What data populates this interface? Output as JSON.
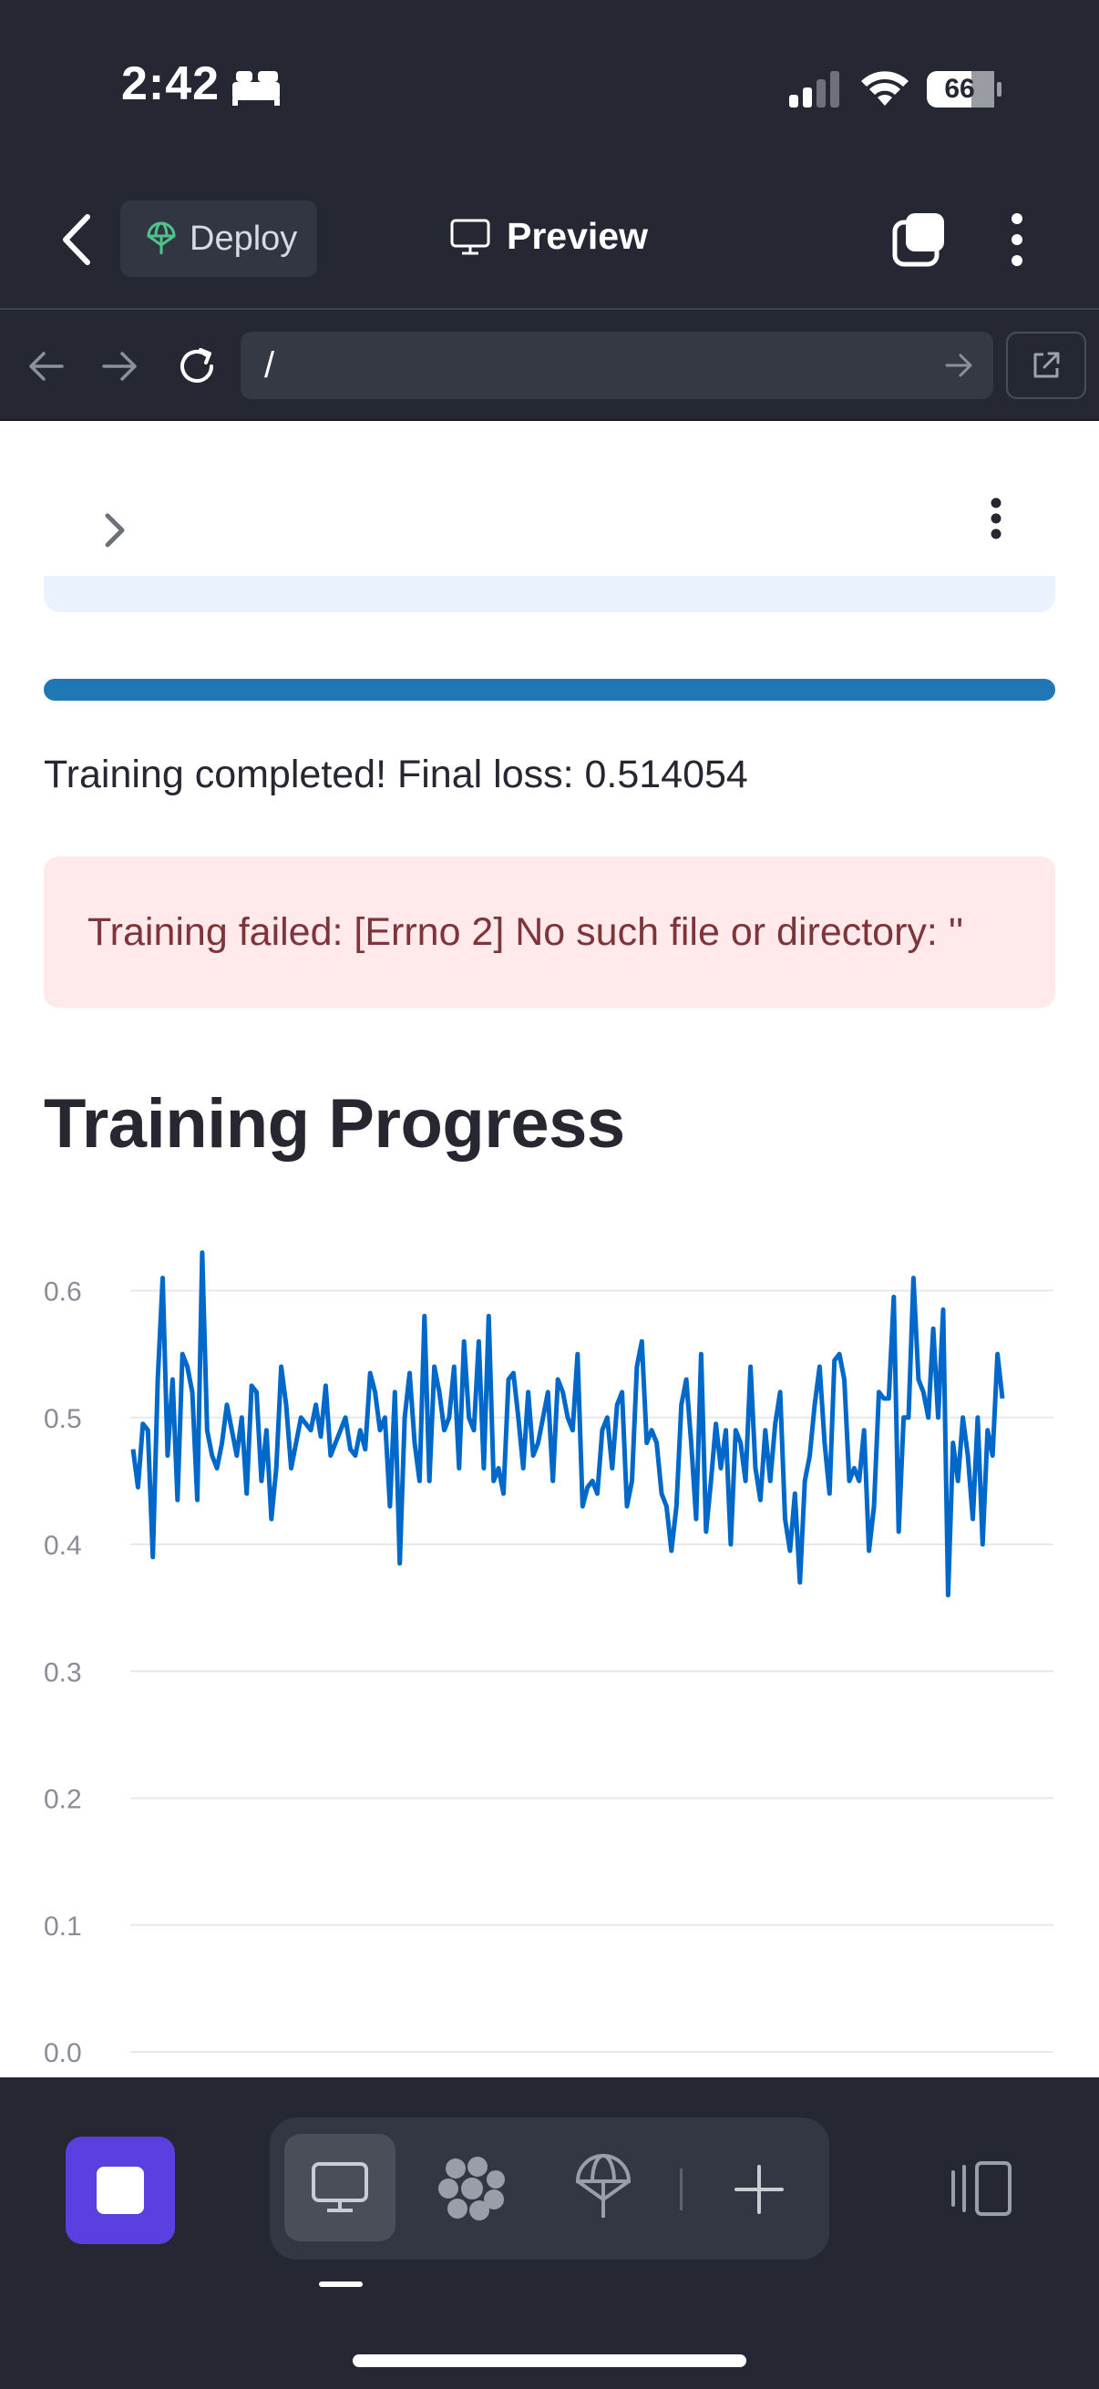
{
  "status_bar": {
    "time": "2:42",
    "battery": "66"
  },
  "app_bar": {
    "deploy_label": "Deploy",
    "preview_label": "Preview"
  },
  "browser": {
    "url": "/"
  },
  "content": {
    "progress": 1.0,
    "status_message": "Training completed! Final loss: 0.514054",
    "error_message": "Training failed: [Errno 2] No such file or directory: ''",
    "section_title": "Training Progress"
  },
  "chart_data": {
    "type": "line",
    "title": "",
    "xlabel": "",
    "ylabel": "",
    "ylim": [
      0.0,
      0.65
    ],
    "y_ticks": [
      "0.0",
      "0.1",
      "0.2",
      "0.3",
      "0.4",
      "0.5",
      "0.6"
    ],
    "grid": true,
    "color": "#0068c9",
    "series": [
      {
        "values": [
          0.475,
          0.445,
          0.495,
          0.49,
          0.39,
          0.53,
          0.61,
          0.47,
          0.53,
          0.435,
          0.55,
          0.54,
          0.52,
          0.435,
          0.63,
          0.49,
          0.47,
          0.46,
          0.48,
          0.51,
          0.49,
          0.47,
          0.5,
          0.44,
          0.525,
          0.52,
          0.45,
          0.49,
          0.42,
          0.46,
          0.54,
          0.51,
          0.46,
          0.48,
          0.5,
          0.495,
          0.49,
          0.51,
          0.485,
          0.525,
          0.47,
          0.48,
          0.49,
          0.5,
          0.475,
          0.47,
          0.49,
          0.475,
          0.535,
          0.52,
          0.49,
          0.5,
          0.43,
          0.52,
          0.385,
          0.5,
          0.535,
          0.48,
          0.45,
          0.58,
          0.45,
          0.54,
          0.52,
          0.49,
          0.5,
          0.54,
          0.46,
          0.56,
          0.5,
          0.49,
          0.56,
          0.46,
          0.58,
          0.45,
          0.46,
          0.44,
          0.53,
          0.535,
          0.5,
          0.46,
          0.52,
          0.47,
          0.48,
          0.5,
          0.52,
          0.45,
          0.53,
          0.52,
          0.5,
          0.49,
          0.55,
          0.43,
          0.445,
          0.45,
          0.44,
          0.49,
          0.5,
          0.46,
          0.51,
          0.52,
          0.43,
          0.45,
          0.54,
          0.56,
          0.48,
          0.49,
          0.48,
          0.44,
          0.43,
          0.395,
          0.43,
          0.51,
          0.53,
          0.48,
          0.42,
          0.55,
          0.41,
          0.45,
          0.495,
          0.46,
          0.49,
          0.4,
          0.49,
          0.48,
          0.45,
          0.54,
          0.46,
          0.435,
          0.49,
          0.45,
          0.495,
          0.52,
          0.42,
          0.395,
          0.44,
          0.37,
          0.45,
          0.47,
          0.51,
          0.54,
          0.48,
          0.44,
          0.545,
          0.55,
          0.53,
          0.45,
          0.46,
          0.45,
          0.49,
          0.395,
          0.43,
          0.52,
          0.515,
          0.515,
          0.595,
          0.41,
          0.5,
          0.5,
          0.61,
          0.53,
          0.52,
          0.5,
          0.57,
          0.5,
          0.585,
          0.36,
          0.48,
          0.45,
          0.5,
          0.47,
          0.42,
          0.5,
          0.4,
          0.49,
          0.47,
          0.55,
          0.515
        ]
      }
    ]
  },
  "bottom_toolbar": {
    "active_tool": "preview"
  }
}
